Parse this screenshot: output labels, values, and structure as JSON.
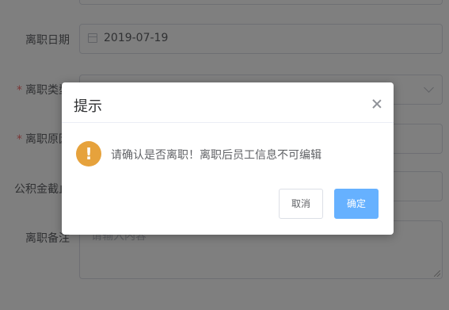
{
  "form": {
    "leave_date_label": "离职日期",
    "leave_date_value": "2019-07-19",
    "leave_type_label": "离职类型",
    "leave_reason_label": "离职原因",
    "fund_label": "公积金截止",
    "remark_label": "离职备注",
    "remark_placeholder": "请输入内容",
    "required_mark": "*"
  },
  "dialog": {
    "title": "提示",
    "message": "请确认是否离职！离职后员工信息不可编辑",
    "icon": "warning-icon",
    "icon_glyph": "!",
    "cancel_label": "取消",
    "confirm_label": "确定"
  },
  "colors": {
    "warning": "#e6a23c",
    "primary": "#66b1ff",
    "required": "#f56c6c"
  }
}
